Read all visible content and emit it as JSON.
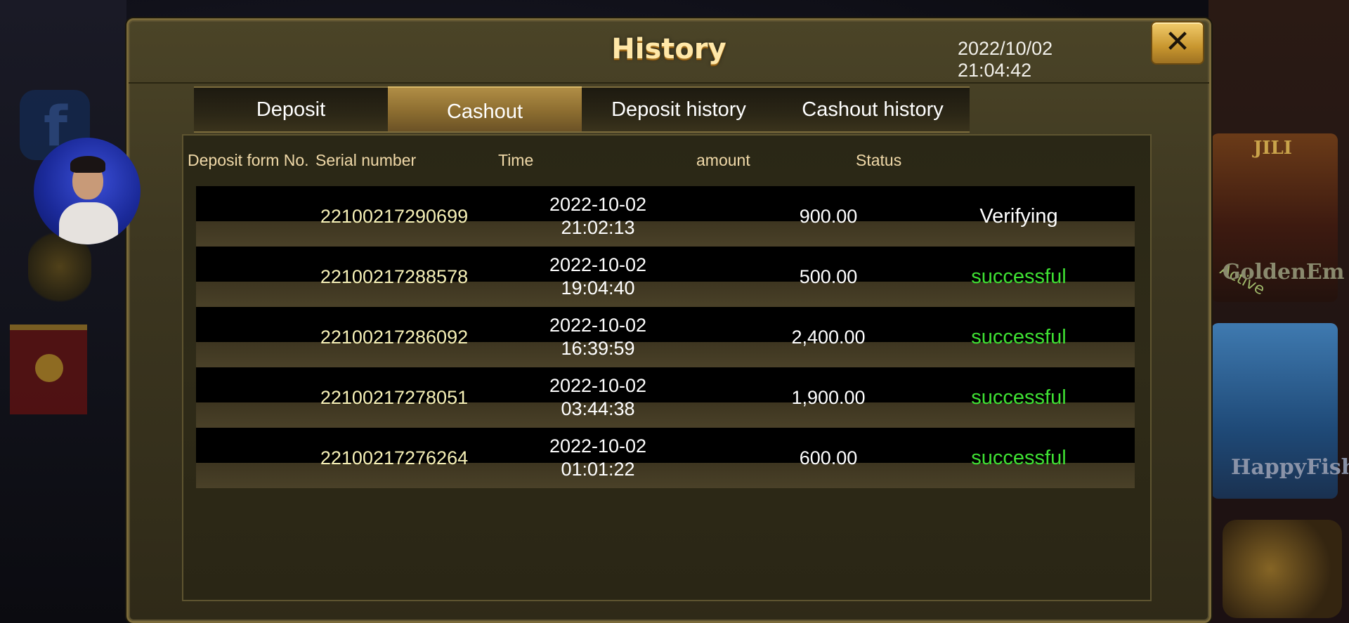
{
  "dialog": {
    "title": "History",
    "datetime": "2022/10/02 21:04:42",
    "close_label": "✕"
  },
  "tabs": [
    {
      "label": "Deposit",
      "active": false
    },
    {
      "label": "Cashout",
      "active": true
    },
    {
      "label": "Deposit history",
      "active": false
    },
    {
      "label": "Cashout history",
      "active": false
    }
  ],
  "table": {
    "headers": {
      "form_no": "Deposit form No.",
      "serial": "Serial number",
      "time": "Time",
      "amount": "amount",
      "status": "Status"
    },
    "rows": [
      {
        "serial": "22100217290699",
        "date": "2022-10-02",
        "clock": "21:02:13",
        "amount": "900.00",
        "status": "Verifying"
      },
      {
        "serial": "22100217288578",
        "date": "2022-10-02",
        "clock": "19:04:40",
        "amount": "500.00",
        "status": "successful"
      },
      {
        "serial": "22100217286092",
        "date": "2022-10-02",
        "clock": "16:39:59",
        "amount": "2,400.00",
        "status": "successful"
      },
      {
        "serial": "22100217278051",
        "date": "2022-10-02",
        "clock": "03:44:38",
        "amount": "1,900.00",
        "status": "successful"
      },
      {
        "serial": "22100217276264",
        "date": "2022-10-02",
        "clock": "01:01:22",
        "amount": "600.00",
        "status": "successful"
      }
    ]
  },
  "background": {
    "fb_glyph": "f",
    "card1_top": "JILI",
    "card1_label": "GoldenEm",
    "card1_badge": "Active",
    "card2_label": "HappyFish"
  },
  "colors": {
    "success": "#3fe033",
    "title_gold": "#ffe7a8",
    "serial": "#f6f0b6"
  },
  "icons": {
    "close": "close-icon",
    "avatar": "avatar"
  }
}
